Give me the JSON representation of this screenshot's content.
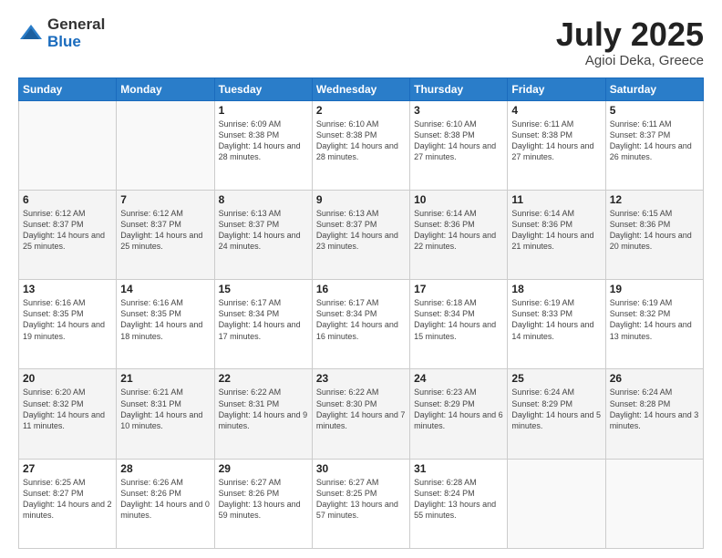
{
  "logo": {
    "general": "General",
    "blue": "Blue"
  },
  "title": {
    "month": "July 2025",
    "location": "Agioi Deka, Greece"
  },
  "weekdays": [
    "Sunday",
    "Monday",
    "Tuesday",
    "Wednesday",
    "Thursday",
    "Friday",
    "Saturday"
  ],
  "weeks": [
    [
      {
        "day": "",
        "sunrise": "",
        "sunset": "",
        "daylight": ""
      },
      {
        "day": "",
        "sunrise": "",
        "sunset": "",
        "daylight": ""
      },
      {
        "day": "1",
        "sunrise": "Sunrise: 6:09 AM",
        "sunset": "Sunset: 8:38 PM",
        "daylight": "Daylight: 14 hours and 28 minutes."
      },
      {
        "day": "2",
        "sunrise": "Sunrise: 6:10 AM",
        "sunset": "Sunset: 8:38 PM",
        "daylight": "Daylight: 14 hours and 28 minutes."
      },
      {
        "day": "3",
        "sunrise": "Sunrise: 6:10 AM",
        "sunset": "Sunset: 8:38 PM",
        "daylight": "Daylight: 14 hours and 27 minutes."
      },
      {
        "day": "4",
        "sunrise": "Sunrise: 6:11 AM",
        "sunset": "Sunset: 8:38 PM",
        "daylight": "Daylight: 14 hours and 27 minutes."
      },
      {
        "day": "5",
        "sunrise": "Sunrise: 6:11 AM",
        "sunset": "Sunset: 8:37 PM",
        "daylight": "Daylight: 14 hours and 26 minutes."
      }
    ],
    [
      {
        "day": "6",
        "sunrise": "Sunrise: 6:12 AM",
        "sunset": "Sunset: 8:37 PM",
        "daylight": "Daylight: 14 hours and 25 minutes."
      },
      {
        "day": "7",
        "sunrise": "Sunrise: 6:12 AM",
        "sunset": "Sunset: 8:37 PM",
        "daylight": "Daylight: 14 hours and 25 minutes."
      },
      {
        "day": "8",
        "sunrise": "Sunrise: 6:13 AM",
        "sunset": "Sunset: 8:37 PM",
        "daylight": "Daylight: 14 hours and 24 minutes."
      },
      {
        "day": "9",
        "sunrise": "Sunrise: 6:13 AM",
        "sunset": "Sunset: 8:37 PM",
        "daylight": "Daylight: 14 hours and 23 minutes."
      },
      {
        "day": "10",
        "sunrise": "Sunrise: 6:14 AM",
        "sunset": "Sunset: 8:36 PM",
        "daylight": "Daylight: 14 hours and 22 minutes."
      },
      {
        "day": "11",
        "sunrise": "Sunrise: 6:14 AM",
        "sunset": "Sunset: 8:36 PM",
        "daylight": "Daylight: 14 hours and 21 minutes."
      },
      {
        "day": "12",
        "sunrise": "Sunrise: 6:15 AM",
        "sunset": "Sunset: 8:36 PM",
        "daylight": "Daylight: 14 hours and 20 minutes."
      }
    ],
    [
      {
        "day": "13",
        "sunrise": "Sunrise: 6:16 AM",
        "sunset": "Sunset: 8:35 PM",
        "daylight": "Daylight: 14 hours and 19 minutes."
      },
      {
        "day": "14",
        "sunrise": "Sunrise: 6:16 AM",
        "sunset": "Sunset: 8:35 PM",
        "daylight": "Daylight: 14 hours and 18 minutes."
      },
      {
        "day": "15",
        "sunrise": "Sunrise: 6:17 AM",
        "sunset": "Sunset: 8:34 PM",
        "daylight": "Daylight: 14 hours and 17 minutes."
      },
      {
        "day": "16",
        "sunrise": "Sunrise: 6:17 AM",
        "sunset": "Sunset: 8:34 PM",
        "daylight": "Daylight: 14 hours and 16 minutes."
      },
      {
        "day": "17",
        "sunrise": "Sunrise: 6:18 AM",
        "sunset": "Sunset: 8:34 PM",
        "daylight": "Daylight: 14 hours and 15 minutes."
      },
      {
        "day": "18",
        "sunrise": "Sunrise: 6:19 AM",
        "sunset": "Sunset: 8:33 PM",
        "daylight": "Daylight: 14 hours and 14 minutes."
      },
      {
        "day": "19",
        "sunrise": "Sunrise: 6:19 AM",
        "sunset": "Sunset: 8:32 PM",
        "daylight": "Daylight: 14 hours and 13 minutes."
      }
    ],
    [
      {
        "day": "20",
        "sunrise": "Sunrise: 6:20 AM",
        "sunset": "Sunset: 8:32 PM",
        "daylight": "Daylight: 14 hours and 11 minutes."
      },
      {
        "day": "21",
        "sunrise": "Sunrise: 6:21 AM",
        "sunset": "Sunset: 8:31 PM",
        "daylight": "Daylight: 14 hours and 10 minutes."
      },
      {
        "day": "22",
        "sunrise": "Sunrise: 6:22 AM",
        "sunset": "Sunset: 8:31 PM",
        "daylight": "Daylight: 14 hours and 9 minutes."
      },
      {
        "day": "23",
        "sunrise": "Sunrise: 6:22 AM",
        "sunset": "Sunset: 8:30 PM",
        "daylight": "Daylight: 14 hours and 7 minutes."
      },
      {
        "day": "24",
        "sunrise": "Sunrise: 6:23 AM",
        "sunset": "Sunset: 8:29 PM",
        "daylight": "Daylight: 14 hours and 6 minutes."
      },
      {
        "day": "25",
        "sunrise": "Sunrise: 6:24 AM",
        "sunset": "Sunset: 8:29 PM",
        "daylight": "Daylight: 14 hours and 5 minutes."
      },
      {
        "day": "26",
        "sunrise": "Sunrise: 6:24 AM",
        "sunset": "Sunset: 8:28 PM",
        "daylight": "Daylight: 14 hours and 3 minutes."
      }
    ],
    [
      {
        "day": "27",
        "sunrise": "Sunrise: 6:25 AM",
        "sunset": "Sunset: 8:27 PM",
        "daylight": "Daylight: 14 hours and 2 minutes."
      },
      {
        "day": "28",
        "sunrise": "Sunrise: 6:26 AM",
        "sunset": "Sunset: 8:26 PM",
        "daylight": "Daylight: 14 hours and 0 minutes."
      },
      {
        "day": "29",
        "sunrise": "Sunrise: 6:27 AM",
        "sunset": "Sunset: 8:26 PM",
        "daylight": "Daylight: 13 hours and 59 minutes."
      },
      {
        "day": "30",
        "sunrise": "Sunrise: 6:27 AM",
        "sunset": "Sunset: 8:25 PM",
        "daylight": "Daylight: 13 hours and 57 minutes."
      },
      {
        "day": "31",
        "sunrise": "Sunrise: 6:28 AM",
        "sunset": "Sunset: 8:24 PM",
        "daylight": "Daylight: 13 hours and 55 minutes."
      },
      {
        "day": "",
        "sunrise": "",
        "sunset": "",
        "daylight": ""
      },
      {
        "day": "",
        "sunrise": "",
        "sunset": "",
        "daylight": ""
      }
    ]
  ]
}
